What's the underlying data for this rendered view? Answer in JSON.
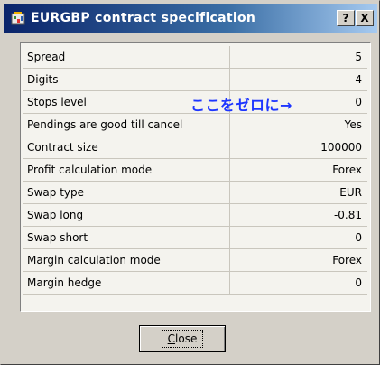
{
  "window": {
    "title": "EURGBP contract specification",
    "help_label": "?",
    "close_label": "X"
  },
  "table": {
    "rows": [
      {
        "name": "Spread",
        "value": "5"
      },
      {
        "name": "Digits",
        "value": "4"
      },
      {
        "name": "Stops level",
        "value": "0"
      },
      {
        "name": "Pendings are good till cancel",
        "value": "Yes"
      },
      {
        "name": "Contract size",
        "value": "100000"
      },
      {
        "name": "Profit calculation mode",
        "value": "Forex"
      },
      {
        "name": "Swap type",
        "value": "EUR"
      },
      {
        "name": "Swap long",
        "value": "-0.81"
      },
      {
        "name": "Swap short",
        "value": "0"
      },
      {
        "name": "Margin calculation mode",
        "value": "Forex"
      },
      {
        "name": "Margin hedge",
        "value": "0"
      }
    ]
  },
  "annotation": {
    "text": "ここをゼロに→"
  },
  "footer": {
    "close_button_first": "C",
    "close_button_rest": "lose"
  },
  "colors": {
    "title_bar_start": "#0a246a",
    "annotation": "#1d35ff"
  }
}
